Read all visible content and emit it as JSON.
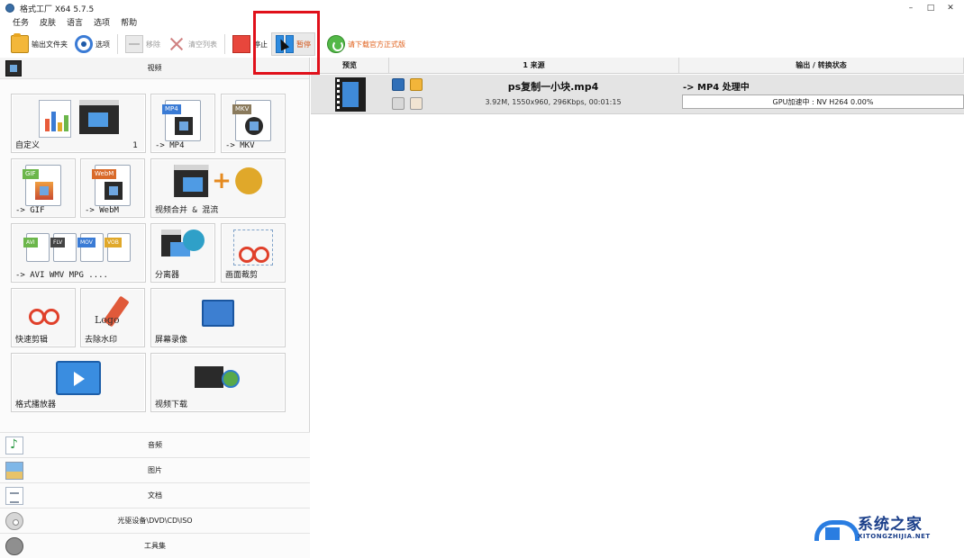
{
  "window": {
    "title": "格式工厂 X64 5.7.5",
    "controls": {
      "minimize": "–",
      "maximize": "□",
      "close": "✕"
    }
  },
  "menu": [
    "任务",
    "皮肤",
    "语言",
    "选项",
    "帮助"
  ],
  "toolbar": {
    "output_folder": "输出文件夹",
    "options": "选项",
    "remove": "移除",
    "clear_list": "清空列表",
    "stop": "停止",
    "pause": "暂停",
    "download_official": "请下载官方正式版",
    "icons": {
      "output_folder": "folder-icon",
      "options": "gear-icon",
      "remove": "remove-icon",
      "clear_list": "clear-x-icon",
      "stop": "stop-icon",
      "pause": "pause-icon",
      "download_official": "refresh-icon"
    }
  },
  "left_panel": {
    "video_header": "视频",
    "tiles": {
      "custom": {
        "label": "自定义",
        "count": "1"
      },
      "mp4": {
        "label": "-> MP4",
        "tag": "MP4"
      },
      "mkv": {
        "label": "-> MKV",
        "tag": "MKV"
      },
      "gif": {
        "label": "-> GIF",
        "tag": "GIF"
      },
      "webm": {
        "label": "-> WebM",
        "tag": "WebM"
      },
      "merge": {
        "label": "视频合并 & 混流"
      },
      "multi": {
        "label": "-> AVI WMV MPG ....",
        "tags": [
          "AVI",
          "FLV",
          "MOV",
          "VOB"
        ]
      },
      "splitter": {
        "label": "分离器"
      },
      "crop": {
        "label": "画面裁剪"
      },
      "quick_cut": {
        "label": "快速剪辑"
      },
      "remove_watermark": {
        "label": "去除水印"
      },
      "screen_record": {
        "label": "屏幕录像"
      },
      "player": {
        "label": "格式播放器"
      },
      "download": {
        "label": "视频下载"
      }
    },
    "categories": [
      {
        "label": "音频",
        "icon": "audio-icon"
      },
      {
        "label": "图片",
        "icon": "image-icon"
      },
      {
        "label": "文档",
        "icon": "document-icon"
      },
      {
        "label": "光驱设备\\DVD\\CD\\ISO",
        "icon": "disc-icon"
      },
      {
        "label": "工具集",
        "icon": "tools-icon"
      }
    ]
  },
  "task_list": {
    "columns": {
      "preview": "预览",
      "source": "1 来源",
      "output": "输出 / 转换状态"
    },
    "rows": [
      {
        "filename": "ps复制一小块.mp4",
        "meta": "3.92M, 1550x960, 296Kbps, 00:01:15",
        "status": "-> MP4 处理中",
        "progress_text": "GPU加速中 : NV H264 0.00%",
        "progress": 0
      }
    ]
  },
  "watermark": {
    "title": "系统之家",
    "url": "XITONGZHIJIA.NET"
  },
  "colors": {
    "highlight": "#e0101a",
    "progress": "#52b04a",
    "accent": "#2e8be0"
  }
}
